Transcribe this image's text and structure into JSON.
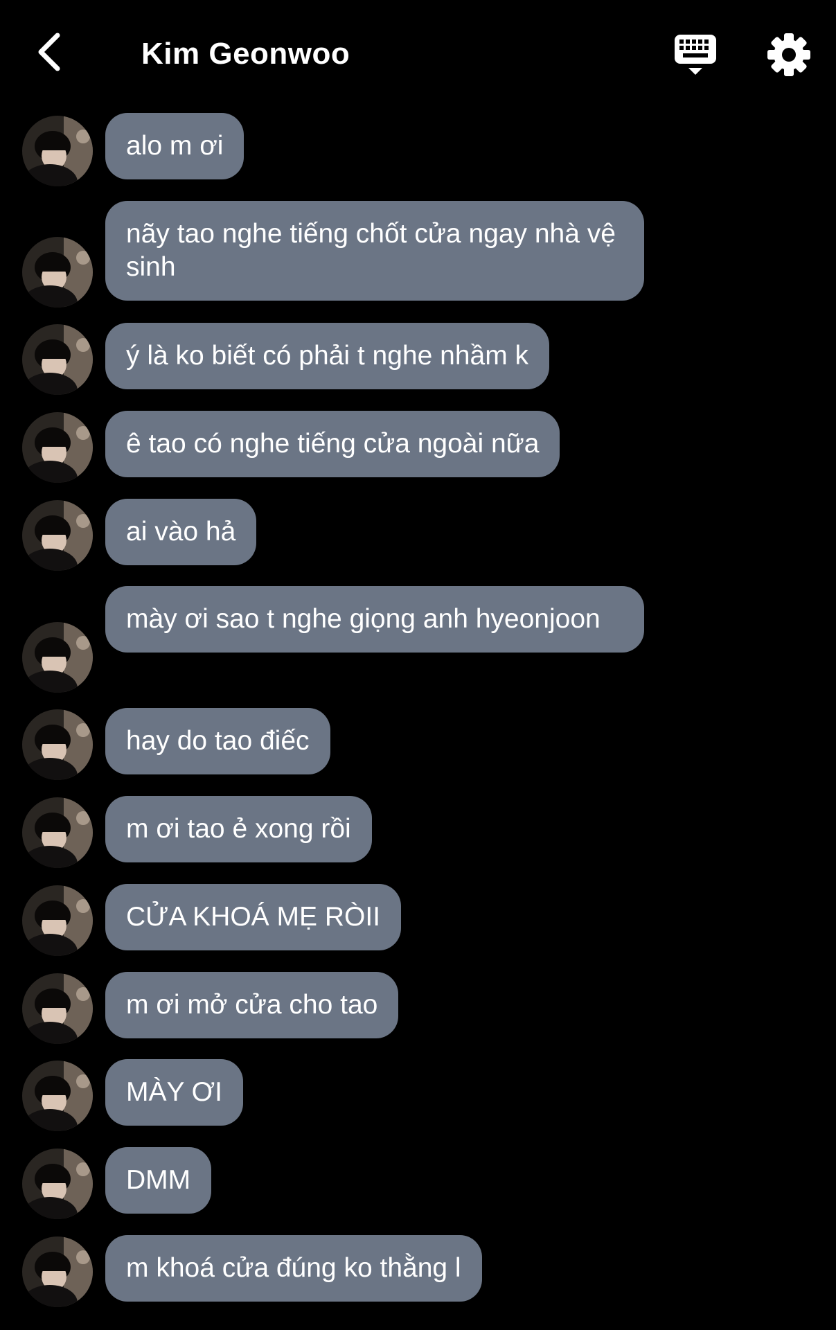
{
  "header": {
    "title": "Kim Geonwoo",
    "back_icon": "chevron-left-icon",
    "keyboard_icon": "keyboard-icon",
    "settings_icon": "gear-icon"
  },
  "colors": {
    "background": "#000000",
    "bubble": "#6b7585",
    "text": "#ffffff"
  },
  "messages": [
    {
      "text": "alo m ơi"
    },
    {
      "text": "nãy tao nghe tiếng chốt cửa ngay nhà vệ sinh"
    },
    {
      "text": "ý là ko biết có phải t nghe nhầm k"
    },
    {
      "text": "ê tao có nghe tiếng cửa ngoài nữa"
    },
    {
      "text": "ai vào hả"
    },
    {
      "text": "mày ơi sao t nghe giọng anh hyeonjoon"
    },
    {
      "text": "hay do tao điếc"
    },
    {
      "text": "m ơi tao ẻ xong rồi"
    },
    {
      "text": "CỬA KHOÁ MẸ RÒII"
    },
    {
      "text": "m ơi mở cửa cho tao"
    },
    {
      "text": "MÀY ƠI"
    },
    {
      "text": "DMM"
    },
    {
      "text": "m khoá cửa đúng ko thằng l"
    }
  ]
}
